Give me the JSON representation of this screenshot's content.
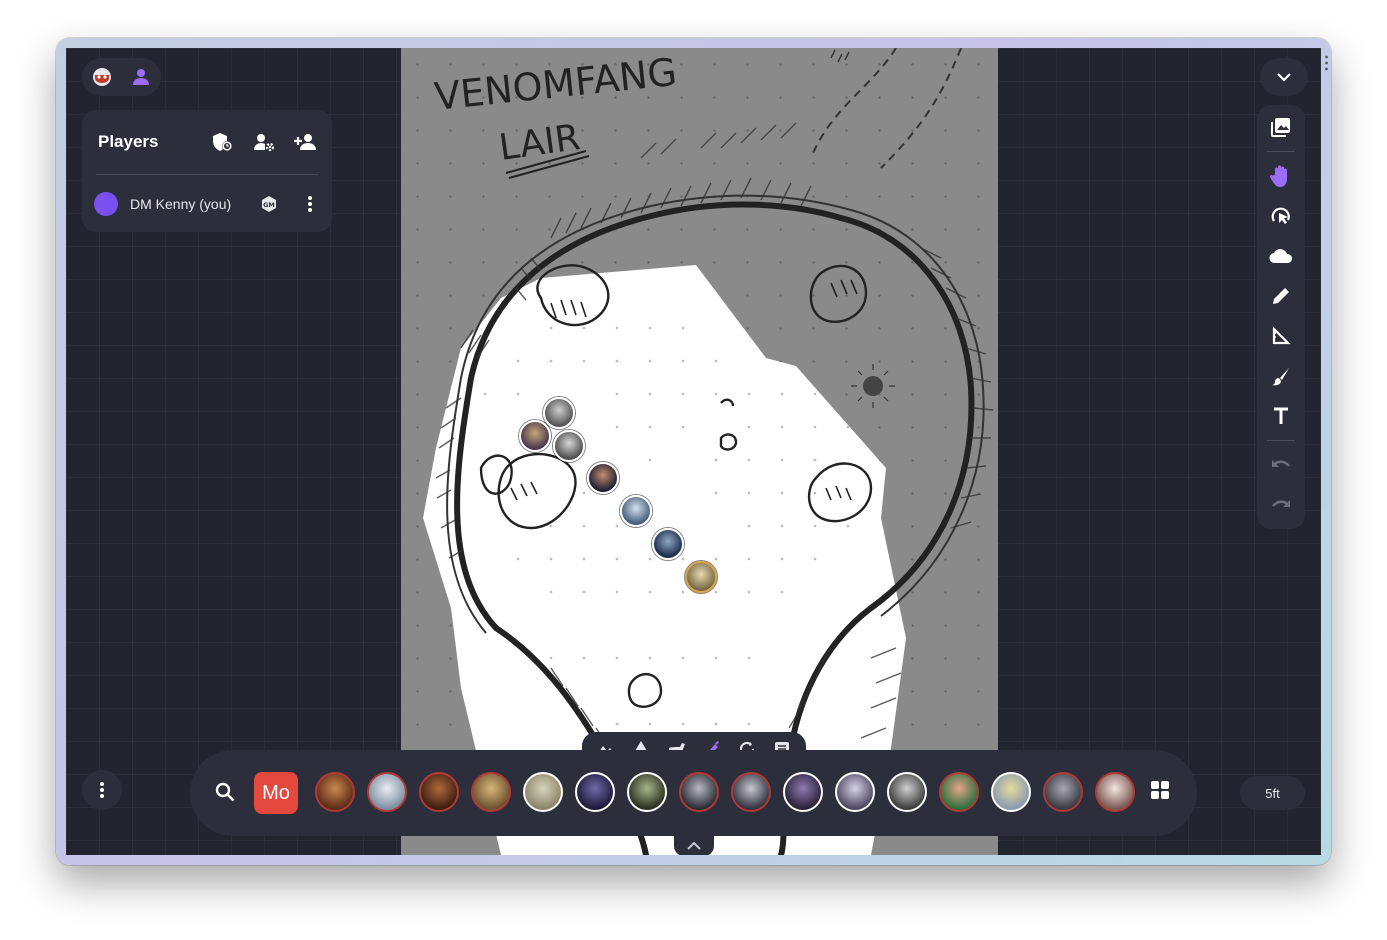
{
  "map": {
    "title_line1": "VENOMFANG",
    "title_line2": "LAIR"
  },
  "players_panel": {
    "title": "Players",
    "players": [
      {
        "name": "DM Kenny (you)",
        "color": "#7a50f0",
        "role_badge": "GM"
      }
    ]
  },
  "top_left": {
    "icons": [
      "dm-mask-icon",
      "player-icon"
    ]
  },
  "right_toolbar": {
    "tools": [
      "image-icon",
      "move-hand-icon",
      "pointer-icon",
      "fog-cloud-icon",
      "draw-pencil-icon",
      "measure-ruler-icon",
      "brush-icon",
      "text-icon",
      "undo-icon",
      "redo-icon"
    ],
    "active_tool": "move-hand-icon"
  },
  "layer_tabs": {
    "tabs": [
      "map-icon",
      "prop-icon",
      "mount-icon",
      "character-icon",
      "attachment-icon",
      "note-icon"
    ],
    "active_tab": "character-icon"
  },
  "asset_bar": {
    "folder_label": "Mo",
    "token_count": 16
  },
  "grid_scale": {
    "label": "5ft"
  },
  "colors": {
    "accent": "#9b6cf5",
    "panel_bg": "#2c2e3b",
    "canvas_bg": "#222430",
    "folder_red": "#e5483c"
  }
}
